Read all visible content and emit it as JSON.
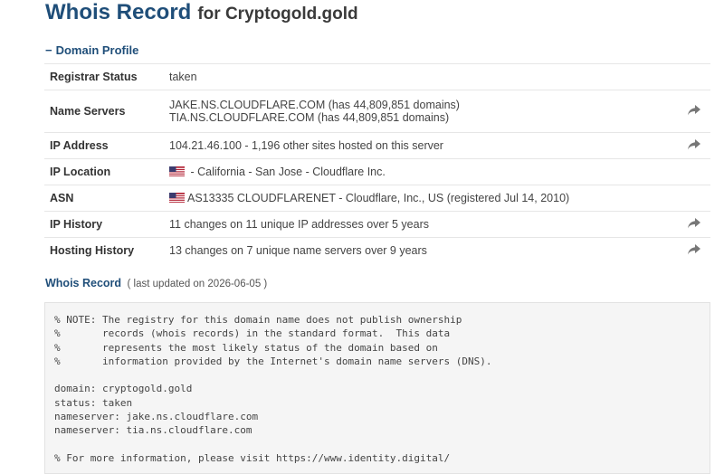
{
  "header": {
    "title": "Whois Record",
    "subtitle": "for Cryptogold.gold"
  },
  "domain_profile": {
    "heading": "Domain Profile",
    "rows": [
      {
        "label": "Registrar Status",
        "value": "taken"
      },
      {
        "label": "Name Servers",
        "value": "JAKE.NS.CLOUDFLARE.COM (has 44,809,851 domains)",
        "value2": "TIA.NS.CLOUDFLARE.COM (has 44,809,851 domains)"
      },
      {
        "label": "IP Address",
        "value": "104.21.46.100 - 1,196 other sites hosted on this server"
      },
      {
        "label": "IP Location",
        "value": " - California - San Jose - Cloudflare Inc."
      },
      {
        "label": "ASN",
        "value": "AS13335 CLOUDFLARENET - Cloudflare, Inc., US (registered Jul 14, 2010)"
      },
      {
        "label": "IP History",
        "value": "11 changes on 11 unique IP addresses over 5 years"
      },
      {
        "label": "Hosting History",
        "value": "13 changes on 7 unique name servers over 9 years"
      }
    ]
  },
  "whois_record": {
    "heading": "Whois Record",
    "updated": "( last updated on 2026-06-05 )",
    "raw": "% NOTE: The registry for this domain name does not publish ownership\n%       records (whois records) in the standard format.  This data\n%       represents the most likely status of the domain based on\n%       information provided by the Internet's domain name servers (DNS).\n\ndomain: cryptogold.gold\nstatus: taken\nnameserver: jake.ns.cloudflare.com\nnameserver: tia.ns.cloudflare.com\n\n% For more information, please visit https://www.identity.digital/"
  },
  "icons": {
    "arrow": "share-arrow-icon",
    "flag": "us-flag-icon"
  },
  "colors": {
    "heading": "#1f4e79",
    "raw_bg": "#f5f5f5",
    "divider": "#e6e6e6"
  }
}
